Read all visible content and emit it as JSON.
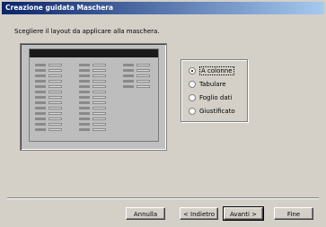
{
  "window": {
    "title": "Creazione guidata Maschera"
  },
  "instruction": "Scegliere il layout da applicare alla maschera.",
  "layout_options": [
    {
      "label": "A colonne",
      "checked": true
    },
    {
      "label": "Tabulare",
      "checked": false
    },
    {
      "label": "Foglio dati",
      "checked": false
    },
    {
      "label": "Giustificato",
      "checked": false
    }
  ],
  "buttons": {
    "cancel": "Annulla",
    "back": "< Indietro",
    "next": "Avanti >",
    "finish": "Fine"
  }
}
